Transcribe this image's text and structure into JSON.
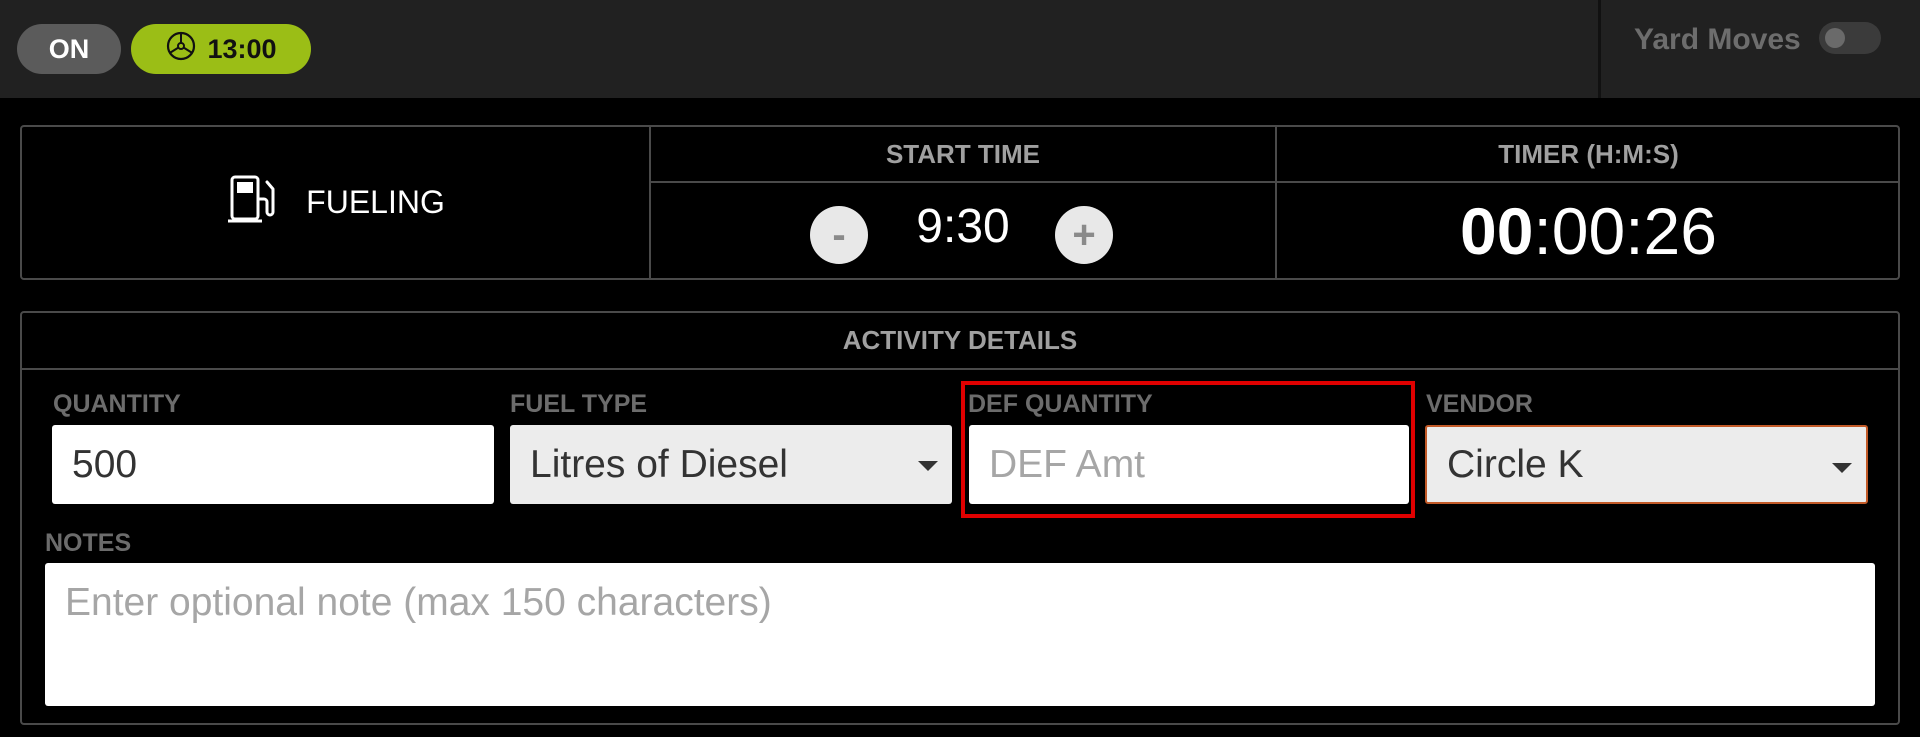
{
  "status_bar": {
    "duty_status": "ON",
    "clock_icon": "steering-wheel-icon",
    "time": "13:00",
    "yard_moves_label": "Yard Moves",
    "yard_moves_enabled": false
  },
  "activity": {
    "icon": "fuel-pump-icon",
    "name": "FUELING",
    "start_time_header": "START TIME",
    "start_time_value": "9:30",
    "decrement_label": "-",
    "increment_label": "+",
    "timer_header": "TIMER (H:M:S)",
    "timer_hours": "00",
    "timer_rest": ":00:26"
  },
  "details": {
    "header": "ACTIVITY DETAILS",
    "quantity": {
      "label": "QUANTITY",
      "value": "500"
    },
    "fuel_type": {
      "label": "FUEL TYPE",
      "selected": "Litres of Diesel"
    },
    "def_quantity": {
      "label": "DEF QUANTITY",
      "placeholder": "DEF Amt",
      "value": ""
    },
    "vendor": {
      "label": "VENDOR",
      "selected": "Circle K"
    },
    "notes": {
      "label": "NOTES",
      "placeholder": "Enter optional note (max 150 characters)"
    }
  },
  "colors": {
    "accent_green": "#9bbe16",
    "highlight_red": "#e00000",
    "vendor_border": "#c25a28"
  }
}
